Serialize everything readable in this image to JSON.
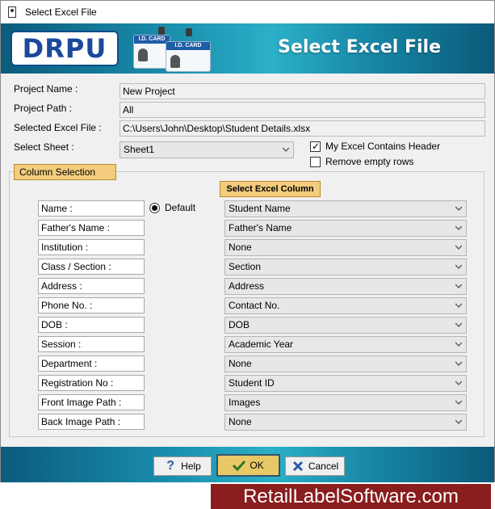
{
  "window": {
    "title": "Select Excel File"
  },
  "banner": {
    "logo": "DRPU",
    "title": "Select Excel File",
    "card_label_1": "I.D. CARD",
    "card_label_2": "I.D. CARD"
  },
  "form": {
    "project_name_label": "Project Name :",
    "project_name_value": "New Project",
    "project_path_label": "Project Path :",
    "project_path_value": "All",
    "excel_file_label": "Selected Excel File :",
    "excel_file_value": "C:\\Users\\John\\Desktop\\Student Details.xlsx",
    "sheet_label": "Select Sheet :",
    "sheet_value": "Sheet1",
    "header_checkbox_label": "My Excel Contains Header",
    "header_checked": true,
    "empty_rows_label": "Remove empty rows",
    "empty_rows_checked": false
  },
  "column_selection": {
    "title": "Column Selection",
    "excel_column_header": "Select Excel Column",
    "default_label": "Default",
    "rows": [
      {
        "field": "Name :",
        "column": "Student Name"
      },
      {
        "field": "Father's Name :",
        "column": "Father's Name"
      },
      {
        "field": "Institution :",
        "column": "None"
      },
      {
        "field": "Class / Section :",
        "column": "Section"
      },
      {
        "field": "Address :",
        "column": "Address"
      },
      {
        "field": "Phone No. :",
        "column": "Contact No."
      },
      {
        "field": "DOB :",
        "column": "DOB"
      },
      {
        "field": "Session :",
        "column": "Academic Year"
      },
      {
        "field": "Department :",
        "column": "None"
      },
      {
        "field": "Registration No :",
        "column": "Student ID"
      },
      {
        "field": "Front Image Path :",
        "column": "Images"
      },
      {
        "field": "Back Image Path :",
        "column": "None"
      }
    ]
  },
  "buttons": {
    "help": "Help",
    "ok": "OK",
    "cancel": "Cancel"
  },
  "watermark": "RetailLabelSoftware.com",
  "colors": {
    "banner": "#1a8fae",
    "tag": "#f3cc7e",
    "ok_button": "#e9c868",
    "watermark": "#8a1d1d"
  }
}
